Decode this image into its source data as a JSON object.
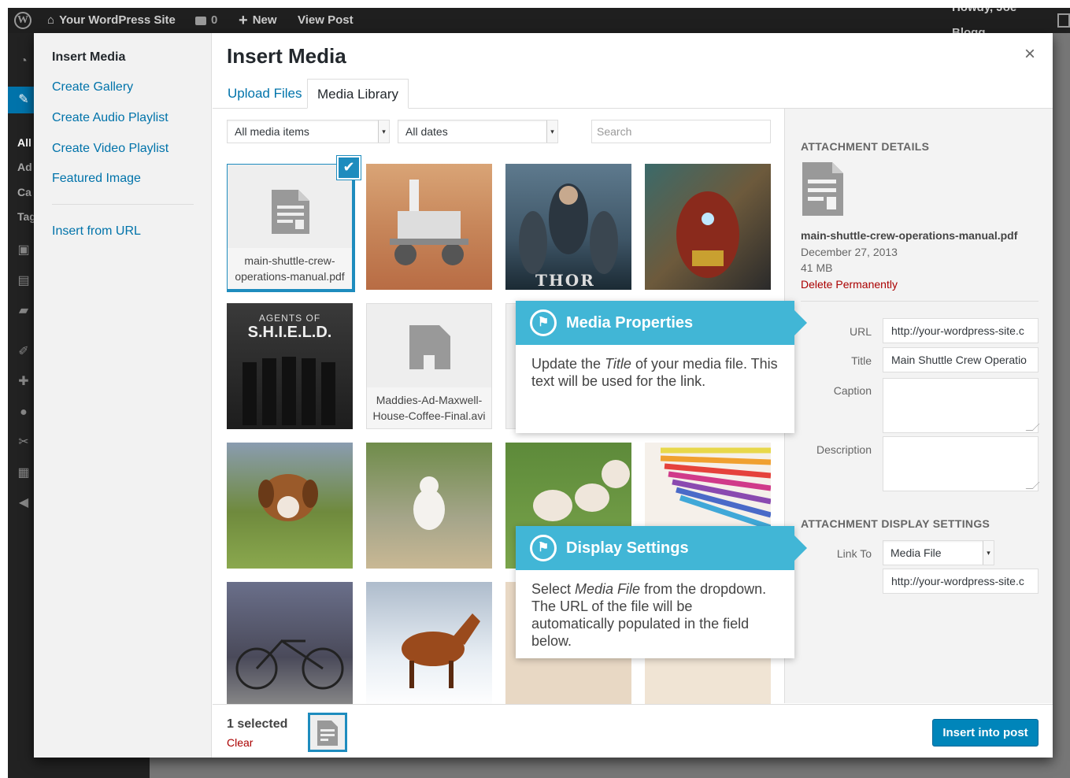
{
  "adminbar": {
    "site_name": "Your WordPress Site",
    "comments_count": "0",
    "new_label": "New",
    "view_post_label": "View Post",
    "howdy": "Howdy, Joe Blogg"
  },
  "adminmenu": {
    "labels": [
      "All",
      "Ad",
      "Ca",
      "Tag"
    ]
  },
  "modal": {
    "left_nav": {
      "current": "Insert Media",
      "create_gallery": "Create Gallery",
      "create_audio_playlist": "Create Audio Playlist",
      "create_video_playlist": "Create Video Playlist",
      "featured_image": "Featured Image",
      "insert_from_url": "Insert from URL"
    },
    "title": "Insert Media",
    "close": "×",
    "tabs": {
      "upload": "Upload Files",
      "library": "Media Library"
    },
    "filters": {
      "type": "All media items",
      "dates": "All dates",
      "search_placeholder": "Search"
    },
    "grid": {
      "pdf_name": "main-shuttle-crew-operations-manual.pdf",
      "avi_name": "Maddies-Ad-Maxwell-House-Coffee-Final.avi",
      "thor_text": "THOR",
      "shield_text1": "AGENTS OF",
      "shield_text2": "S.H.I.E.L.D."
    },
    "sidebar": {
      "details_heading": "ATTACHMENT DETAILS",
      "filename": "main-shuttle-crew-operations-manual.pdf",
      "date": "December 27, 2013",
      "size": "41 MB",
      "delete": "Delete Permanently",
      "url_label": "URL",
      "url_value": "http://your-wordpress-site.c",
      "title_label": "Title",
      "title_value": "Main Shuttle Crew Operatio",
      "caption_label": "Caption",
      "description_label": "Description",
      "display_heading": "ATTACHMENT DISPLAY SETTINGS",
      "link_to_label": "Link To",
      "link_to_value": "Media File",
      "link_url_value": "http://your-wordpress-site.c"
    },
    "callouts": {
      "media_properties_title": "Media Properties",
      "media_properties_body_1": "Update the ",
      "media_properties_body_em": "Title",
      "media_properties_body_2": " of your media file. This text will be used for the link.",
      "display_settings_title": "Display Settings",
      "display_settings_body_1": "Select ",
      "display_settings_body_em": "Media File",
      "display_settings_body_2": " from the dropdown. The URL of the file will be automatically populated in the field below."
    },
    "toolbar": {
      "selected": "1 selected",
      "clear": "Clear",
      "insert_button": "Insert into post"
    }
  }
}
